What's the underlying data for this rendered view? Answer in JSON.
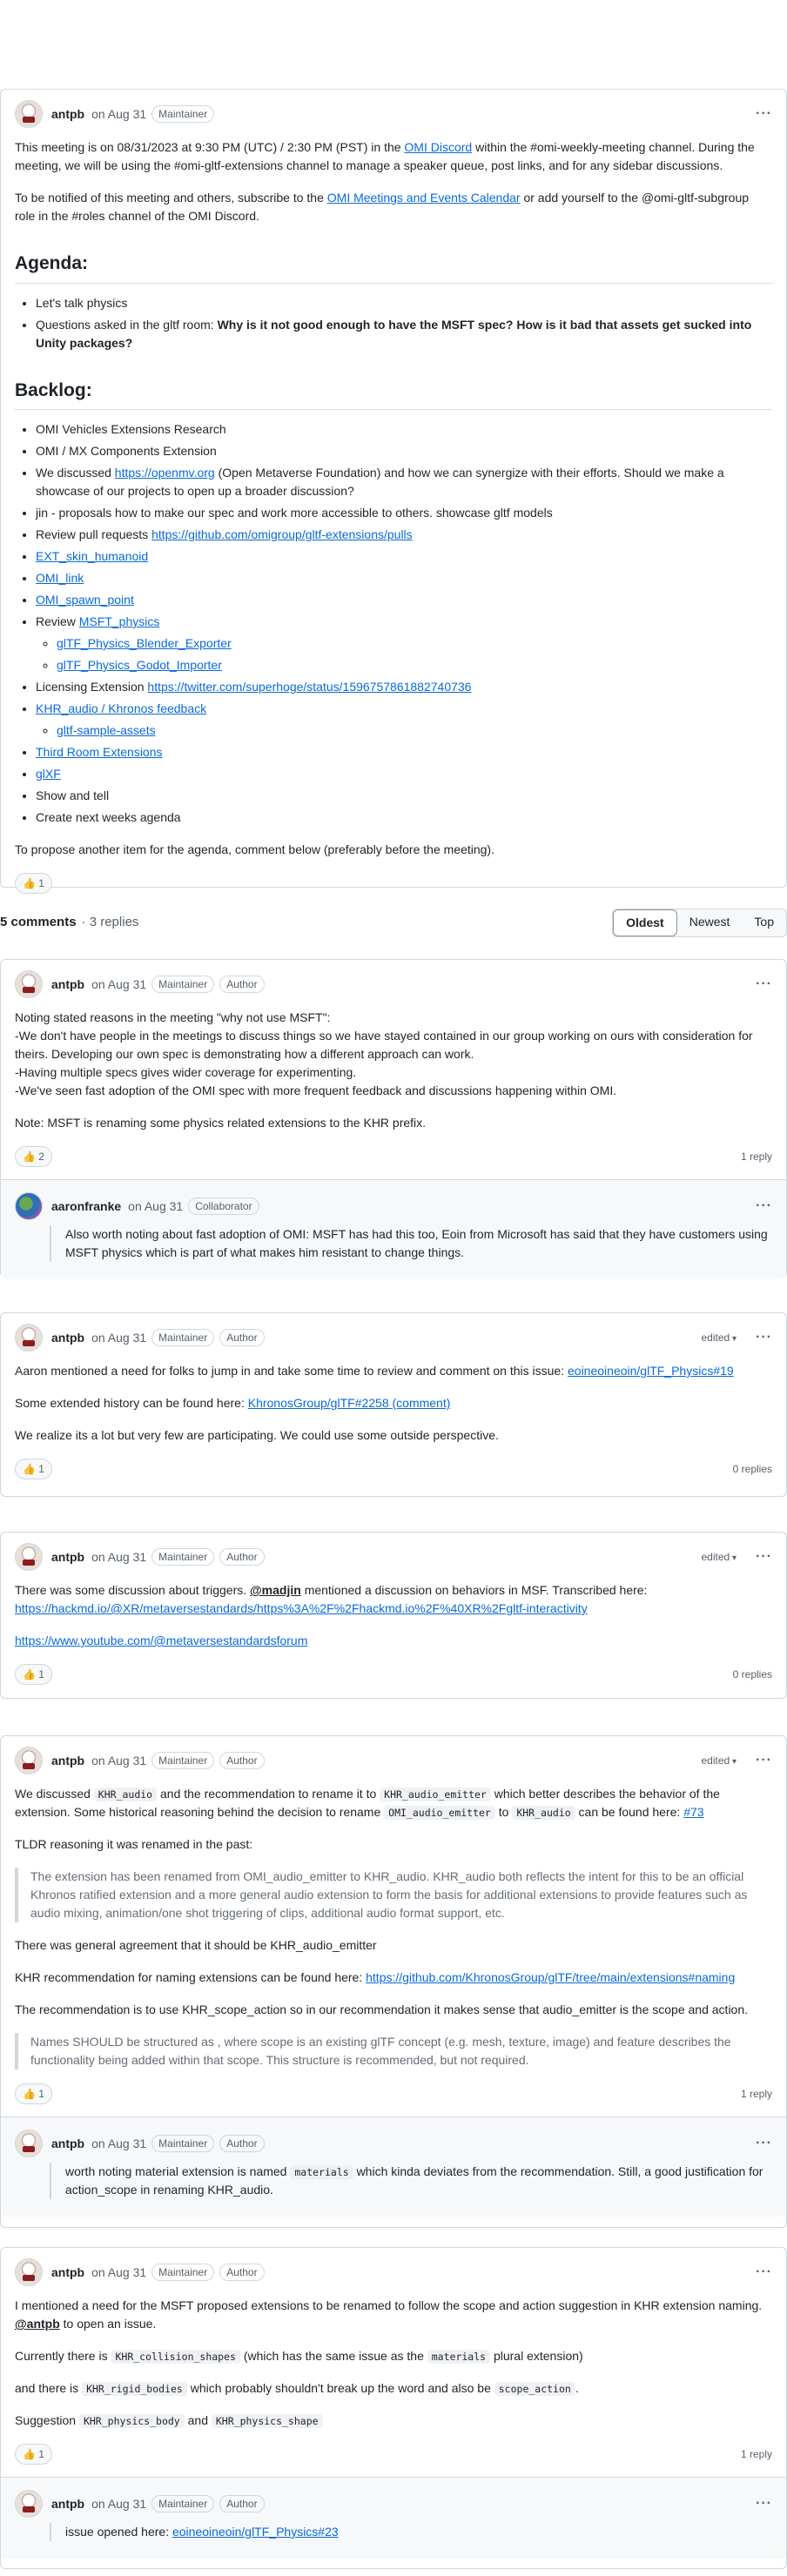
{
  "post": {
    "author": "antpb",
    "date": "on Aug 31",
    "badges": [
      "Maintainer"
    ],
    "para1_a": "This meeting is on 08/31/2023 at 9:30 PM (UTC) / 2:30 PM (PST) in the",
    "para1_link": "OMI Discord",
    "para1_b": "within the #omi-weekly-meeting channel. During the meeting, we will be using the #omi-gltf-extensions channel to manage a speaker queue, post links, and for any sidebar discussions.",
    "para2_a": "To be notified of this meeting and others, subscribe to the",
    "para2_link": "OMI Meetings and Events Calendar",
    "para2_b": "or add yourself to the @omi-gltf-subgroup role in the #roles channel of the OMI Discord.",
    "agenda_title": "Agenda:",
    "agenda_items": [
      "Let's talk physics",
      "Questions asked in the gltf room:"
    ],
    "agenda_bold": "Why is it not good enough to have the MSFT spec? How is it bad that assets get sucked into Unity packages?",
    "backlog_title": "Backlog:",
    "backlog": {
      "item1": "OMI Vehicles Extensions Research",
      "item2": "OMI / MX Components Extension",
      "item3_a": "We discussed",
      "item3_link": "https://openmv.org",
      "item3_b": "(Open Metaverse Foundation) and how we can synergize with their efforts. Should we make a showcase of our projects to open up a broader discussion?",
      "item4": "jin - proposals how to make our spec and work more accessible to others. showcase gltf models",
      "item5_a": "Review pull requests",
      "item5_link": "https://github.com/omigroup/gltf-extensions/pulls",
      "item6": "EXT_skin_humanoid",
      "item7": "OMI_link",
      "item8": "OMI_spawn_point",
      "item9_a": "Review",
      "item9_link": "MSFT_physics",
      "item9_sub1": "glTF_Physics_Blender_Exporter",
      "item9_sub2": "glTF_Physics_Godot_Importer",
      "item10_a": "Licensing Extension",
      "item10_link": "https://twitter.com/superhoge/status/1596757861882740736",
      "item11": "KHR_audio / Khronos feedback",
      "item11_sub": "gltf-sample-assets",
      "item12": "Third Room Extensions",
      "item13": "glXF",
      "item14": "Show and tell",
      "item15": "Create next weeks agenda"
    },
    "closing": "To propose another item for the agenda, comment below (preferably before the meeting).",
    "reaction": "👍 1"
  },
  "comments_bar": {
    "count": "5 comments",
    "sub": "· 3 replies",
    "sort": [
      "Oldest",
      "Newest",
      "Top"
    ]
  },
  "c1": {
    "author": "antpb",
    "date": "on Aug 31",
    "lines": [
      "Noting stated reasons in the meeting \"why not use MSFT\":",
      "-We don't have people in the meetings to discuss things so we have stayed contained in our group working on ours with consideration for theirs. Developing our own spec is demonstrating how a different approach can work.",
      "-Having multiple specs gives wider coverage for experimenting.",
      "-We've seen fast adoption of the OMI spec with more frequent feedback and discussions happening within OMI."
    ],
    "note": "Note: MSFT is renaming some physics related extensions to the KHR prefix.",
    "reaction": "👍 2",
    "replies": "1 reply",
    "reply": {
      "author": "aaronfranke",
      "date": "on Aug 31",
      "badge": "Collaborator",
      "text": "Also worth noting about fast adoption of OMI: MSFT has had this too, Eoin from Microsoft has said that they have customers using MSFT physics which is part of what makes him resistant to change things."
    }
  },
  "c2": {
    "author": "antpb",
    "date": "on Aug 31",
    "edited": "edited",
    "p1_a": "Aaron mentioned a need for folks to jump in and take some time to review and comment on this issue:",
    "p1_link": "eoineoineoin/glTF_Physics#19",
    "p2_a": "Some extended history can be found here:",
    "p2_link": "KhronosGroup/glTF#2258 (comment)",
    "p3": "We realize its a lot but very few are participating. We could use some outside perspective.",
    "reaction": "👍 1",
    "replies": "0 replies"
  },
  "c3": {
    "author": "antpb",
    "date": "on Aug 31",
    "edited": "edited",
    "p1_a": "There was some discussion about triggers.",
    "p1_mention": "@madjin",
    "p1_b": "mentioned a discussion on behaviors in MSF. Transcribed here:",
    "p1_link": "https://hackmd.io/@XR/metaversestandards/https%3A%2F%2Fhackmd.io%2F%40XR%2Fgltf-interactivity",
    "p2_link": "https://www.youtube.com/@metaversestandardsforum",
    "reaction": "👍 1",
    "replies": "0 replies"
  },
  "c4": {
    "author": "antpb",
    "date": "on Aug 31",
    "edited": "edited",
    "p1_a": "We discussed",
    "p1_code1": "KHR_audio",
    "p1_b": "and the recommendation to rename it to",
    "p1_code2": "KHR_audio_emitter",
    "p1_c": "which better describes the behavior of the extension. Some historical reasoning behind the decision to rename",
    "p1_code3": "OMI_audio_emitter",
    "p1_d": "to",
    "p1_code4": "KHR_audio",
    "p1_e": "can be found here:",
    "p1_link": "#73",
    "p2": "TLDR reasoning it was renamed in the past:",
    "quote1": "The extension has been renamed from OMI_audio_emitter to KHR_audio. KHR_audio both reflects the intent for this to be an official Khronos ratified extension and a more general audio extension to form the basis for additional extensions to provide features such as audio mixing, animation/one shot triggering of clips, additional audio format support, etc.",
    "p3": "There was general agreement that it should be KHR_audio_emitter",
    "p4_a": "KHR recommendation for naming extensions can be found here:",
    "p4_link": "https://github.com/KhronosGroup/glTF/tree/main/extensions#naming",
    "p5": "The recommendation is to use KHR_scope_action so in our recommendation it makes sense that audio_emitter is the scope and action.",
    "quote2": "Names SHOULD be structured as , where scope is an existing glTF concept (e.g. mesh, texture, image) and feature describes the functionality being added within that scope. This structure is recommended, but not required.",
    "reaction": "👍 1",
    "replies": "1 reply",
    "reply": {
      "author": "antpb",
      "date": "on Aug 31",
      "text_a": "worth noting material extension is named",
      "code": "materials",
      "text_b": "which kinda deviates from the recommendation. Still, a good justification for action_scope in renaming KHR_audio."
    }
  },
  "c5": {
    "author": "antpb",
    "date": "on Aug 31",
    "p1": "I mentioned a need for the MSFT proposed extensions to be renamed to follow the scope and action suggestion in KHR extension naming.",
    "p1_mention": "@antpb",
    "p1_b": "to open an issue.",
    "p2_a": "Currently there is",
    "p2_code1": "KHR_collision_shapes",
    "p2_b": "(which has the same issue as the",
    "p2_code2": "materials",
    "p2_c": "plural extension)",
    "p3_a": "and there is",
    "p3_code1": "KHR_rigid_bodies",
    "p3_b": "which probably shouldn't break up the word and also be",
    "p3_code2": "scope_action",
    "p3_c": ".",
    "p4_a": "Suggestion",
    "p4_code1": "KHR_physics_body",
    "p4_b": "and",
    "p4_code2": "KHR_physics_shape",
    "reaction": "👍 1",
    "replies": "1 reply",
    "reply": {
      "author": "antpb",
      "date": "on Aug 31",
      "text_a": "issue opened here:",
      "link": "eoineoineoin/glTF_Physics#23"
    }
  },
  "badges": {
    "maintainer": "Maintainer",
    "author": "Author"
  }
}
